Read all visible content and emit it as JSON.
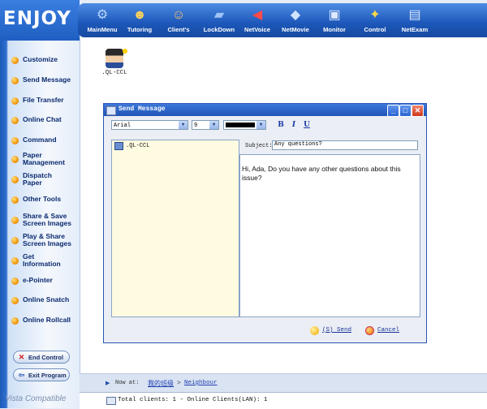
{
  "sidebar": {
    "brand": "ENJOY",
    "items": [
      {
        "label": "Customize",
        "icon": "bullet-icon"
      },
      {
        "label": "Send Message",
        "icon": "bullet-icon"
      },
      {
        "label": "File Transfer",
        "icon": "bullet-icon"
      },
      {
        "label": "Online Chat",
        "icon": "bullet-icon"
      },
      {
        "label": "Command",
        "icon": "bullet-icon"
      },
      {
        "label": "Paper Management",
        "icon": "bullet-icon"
      },
      {
        "label": "Dispatch Paper",
        "icon": "bullet-icon"
      },
      {
        "label": "Other Tools",
        "icon": "bullet-icon"
      },
      {
        "label": "Share & Save Screen Images",
        "icon": "bullet-icon"
      },
      {
        "label": "Play & Share Screen Images",
        "icon": "bullet-icon"
      },
      {
        "label": "Get Information",
        "icon": "bullet-icon"
      },
      {
        "label": "e-Pointer",
        "icon": "bullet-icon"
      },
      {
        "label": "Online Snatch",
        "icon": "bullet-icon"
      },
      {
        "label": "Online Rollcall",
        "icon": "bullet-icon"
      }
    ],
    "end_control": "End Control",
    "exit_program": "Exit Program",
    "footer": "Vista Compatible"
  },
  "toolbar": {
    "items": [
      {
        "label": "MainMenu",
        "icon": "gear-icon"
      },
      {
        "label": "Tutoring",
        "icon": "tutor-icon"
      },
      {
        "label": "Client's",
        "icon": "clients-icon"
      },
      {
        "label": "LockDown",
        "icon": "lock-icon"
      },
      {
        "label": "NetVoice",
        "icon": "megaphone-icon"
      },
      {
        "label": "NetMovie",
        "icon": "movie-icon"
      },
      {
        "label": "Monitor",
        "icon": "monitor-icon"
      },
      {
        "label": "Control",
        "icon": "satellite-icon"
      },
      {
        "label": "NetExam",
        "icon": "exam-icon"
      }
    ]
  },
  "client": {
    "name": ".QL-CCL"
  },
  "dialog": {
    "title": "Send Message",
    "font": "Arial",
    "size": "9",
    "bold": "B",
    "italic": "I",
    "underline": "U",
    "recipient": ".QL-CCL",
    "subject_label": "Subject:",
    "subject_value": "Any questions?",
    "message": "Hi, Ada, Do you have any other questions about this issue?",
    "send_label": "(S) Send",
    "cancel_label": "Cancel",
    "minimize_glyph": "_",
    "maximize_glyph": "□",
    "close_glyph": "✕"
  },
  "breadcrumb": {
    "prefix": "Now at:",
    "group": "我的班级",
    "separator": ">",
    "current": "Neighbour"
  },
  "status": {
    "text": "Total clients: 1  -  Online Clients(LAN): 1"
  }
}
